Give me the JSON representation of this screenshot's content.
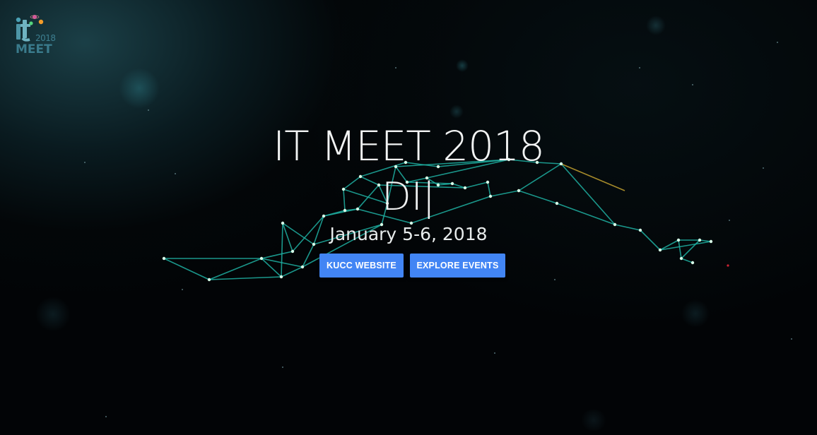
{
  "logo": {
    "mark": "it",
    "year": "2018",
    "name": "MEET"
  },
  "hero": {
    "title": "IT MEET 2018",
    "typed_text": "DI",
    "cursor": "|",
    "date": "January 5-6, 2018"
  },
  "buttons": {
    "primary_label": "KUCC WEBSITE",
    "secondary_label": "EXPLORE EVENTS"
  },
  "colors": {
    "button": "#4285f4",
    "network_line": "#1fb0a2",
    "network_node": "#d7ffe8",
    "background": "#000000"
  }
}
